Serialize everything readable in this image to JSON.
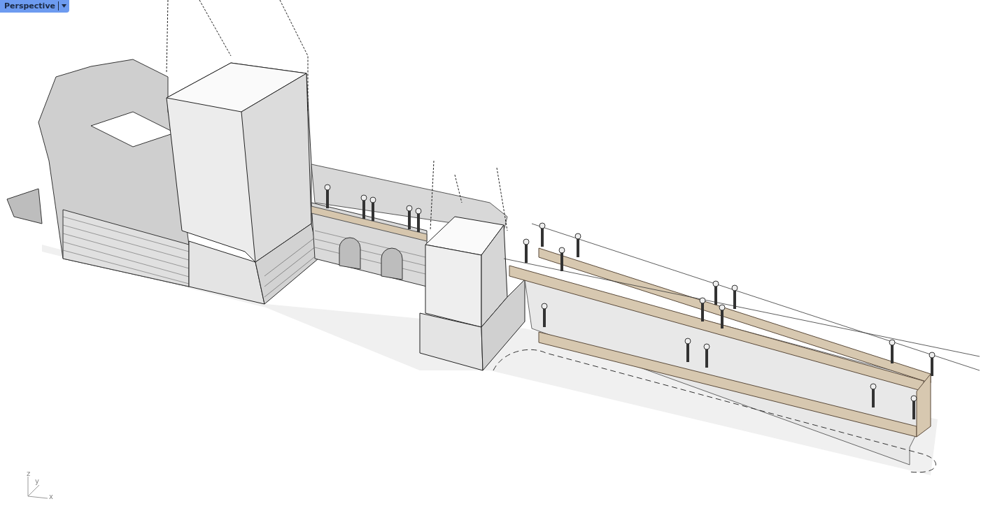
{
  "viewport": {
    "title": "Perspective"
  },
  "axes": {
    "labels": [
      "z",
      "y",
      "x"
    ]
  }
}
